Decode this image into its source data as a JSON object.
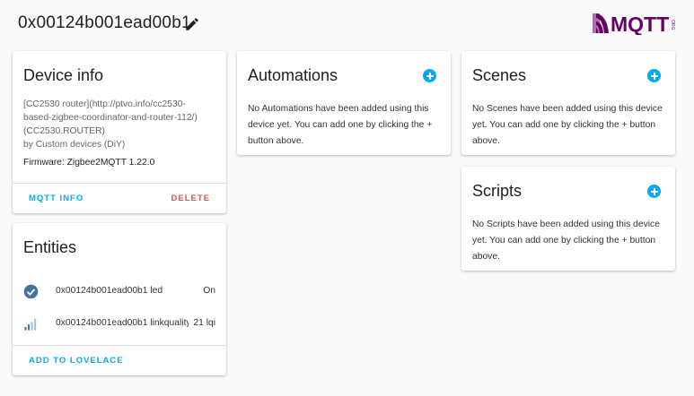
{
  "header": {
    "title": "0x00124b001ead00b1",
    "edit_icon": "pencil-icon",
    "logo_text": "MQTT",
    "logo_sub": "ORG"
  },
  "device_info": {
    "title": "Device info",
    "model_line1": "[CC2530 router](http://ptvo.info/cc2530-",
    "model_line2": "based-zigbee-coordinator-and-router-112/)",
    "model_line3": "(CC2530.ROUTER)",
    "manufacturer": "by Custom devices (DiY)",
    "firmware": "Firmware: Zigbee2MQTT 1.22.0",
    "mqtt_info_label": "MQTT INFO",
    "delete_label": "DELETE"
  },
  "entities": {
    "title": "Entities",
    "items": [
      {
        "icon": "check-circle-icon",
        "name": "0x00124b001ead00b1 led",
        "state": "On"
      },
      {
        "icon": "signal-icon",
        "name": "0x00124b001ead00b1 linkquality",
        "state": "21 lqi"
      }
    ],
    "add_label": "ADD TO LOVELACE"
  },
  "automations": {
    "title": "Automations",
    "text_line1": "No Automations have been added using this",
    "text_line2": "device yet. You can add one by clicking the +",
    "text_line3": "button above."
  },
  "scenes": {
    "title": "Scenes",
    "text_line1": "No Scenes have been added using this device",
    "text_line2": "yet. You can add one by clicking the + button",
    "text_line3": "above."
  },
  "scripts": {
    "title": "Scripts",
    "text_line1": "No Scripts have been added using this device",
    "text_line2": "yet. You can add one by clicking the + button",
    "text_line3": "above."
  },
  "colors": {
    "accent": "#03a9f4",
    "danger": "#d9534f",
    "entity_icon": "#44739e",
    "logo": "#660066"
  }
}
